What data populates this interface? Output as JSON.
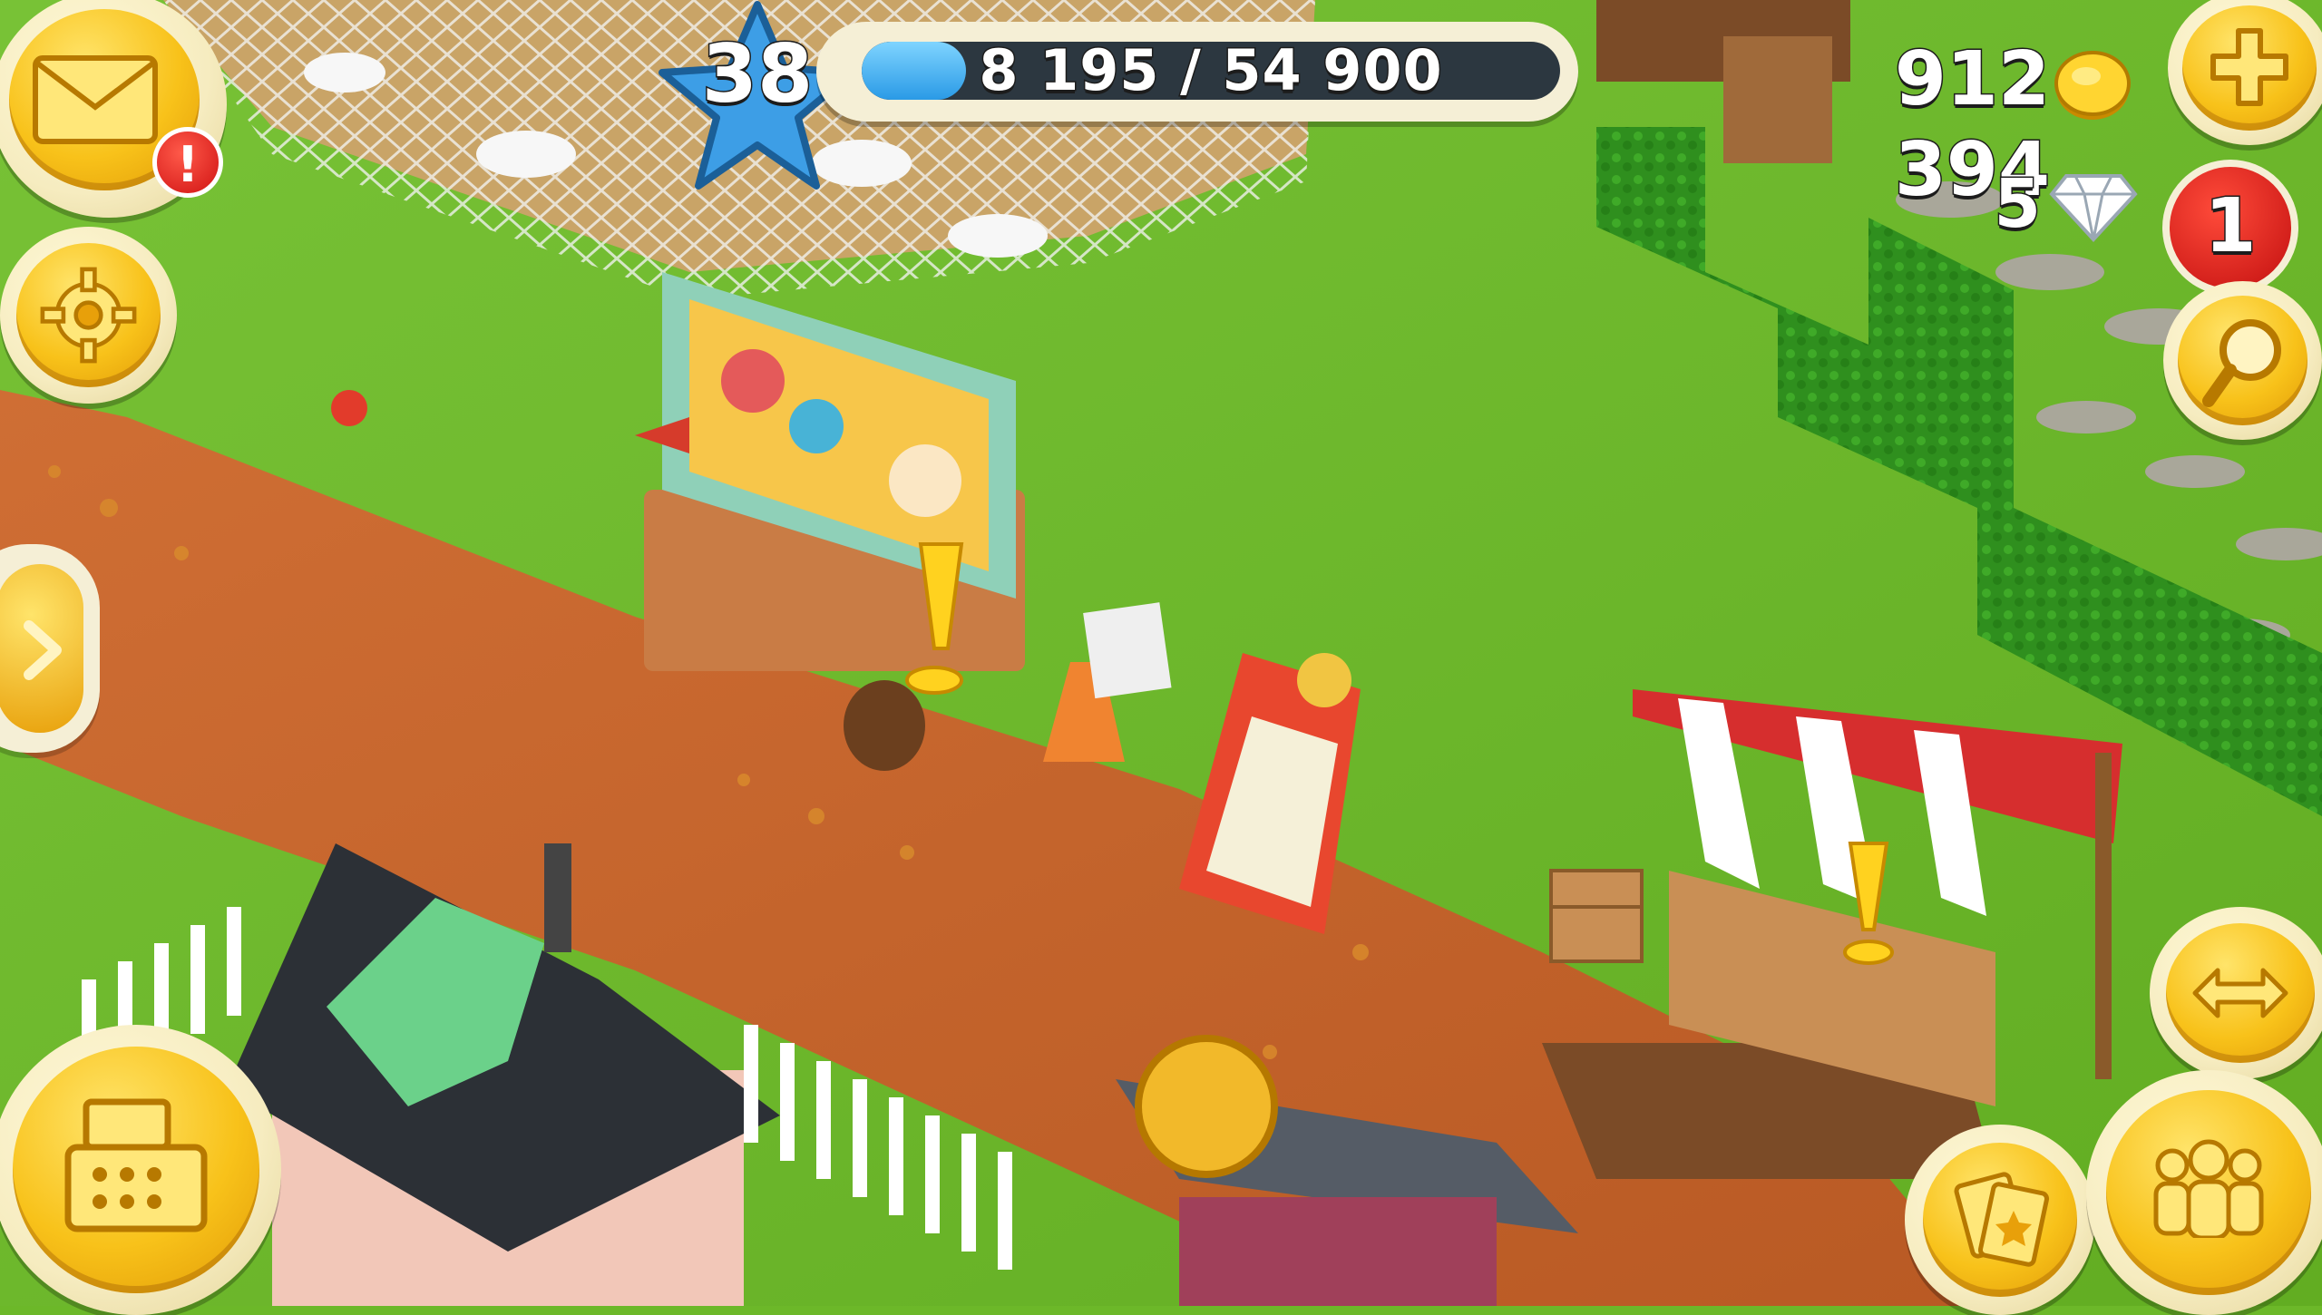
{
  "hud": {
    "level": "38",
    "xp": {
      "current": 8195,
      "max": 54900,
      "label": "8 195 / 54 900",
      "fill_fraction": 0.149
    },
    "coins": "912 394",
    "gems": "5",
    "notification_count": "1",
    "mail_alert": "!"
  },
  "icons": {
    "mail": "envelope-icon",
    "settings": "gear-icon",
    "expand": "chevron-right-icon",
    "shop": "cash-register-icon",
    "add_currency": "plus-icon",
    "search": "magnifier-icon",
    "map": "map-icon",
    "cards": "cards-icon",
    "friends": "friends-icon",
    "coin": "coin-icon",
    "gem": "diamond-icon"
  },
  "colors": {
    "hud_gold": "#f8c21a",
    "hud_cream": "#f5efd6",
    "xp_blue": "#2a9ae6",
    "badge_red": "#d01212",
    "grass": "#6cb829",
    "road": "#c8662e"
  }
}
